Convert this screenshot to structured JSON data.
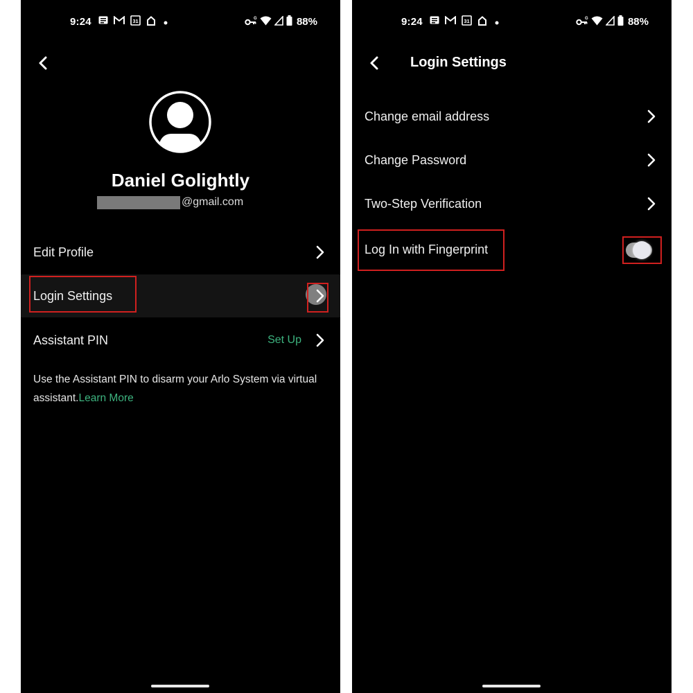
{
  "colors": {
    "accent_green": "#3db37f",
    "annotation_red": "#d0201f",
    "background": "#000000",
    "highlight_row": "#141414"
  },
  "status_bar": {
    "time": "9:24",
    "left_icons": [
      "messages-icon",
      "gmail-icon",
      "calendar-icon",
      "home-icon",
      "dot-icon"
    ],
    "calendar_day": "31",
    "right_icons": [
      "vpn-key-icon",
      "wifi-icon",
      "cell-signal-icon",
      "battery-icon"
    ],
    "battery_percent": "88%"
  },
  "left_screen": {
    "profile": {
      "name": "Daniel Golightly",
      "email_visible_part": "@gmail.com",
      "email_redacted": true
    },
    "rows": [
      {
        "label": "Edit Profile"
      },
      {
        "label": "Login Settings",
        "highlighted": true,
        "annotated": true
      },
      {
        "label": "Assistant PIN",
        "value": "Set Up"
      }
    ],
    "note": {
      "text": "Use the Assistant PIN to disarm your Arlo System via virtual assistant.",
      "link": "Learn More"
    }
  },
  "right_screen": {
    "title": "Login Settings",
    "rows": [
      {
        "label": "Change email address"
      },
      {
        "label": "Change Password"
      },
      {
        "label": "Two-Step Verification"
      },
      {
        "label": "Log In with Fingerprint",
        "toggle": true,
        "toggle_state": "being toggled",
        "annotated": true
      }
    ]
  }
}
